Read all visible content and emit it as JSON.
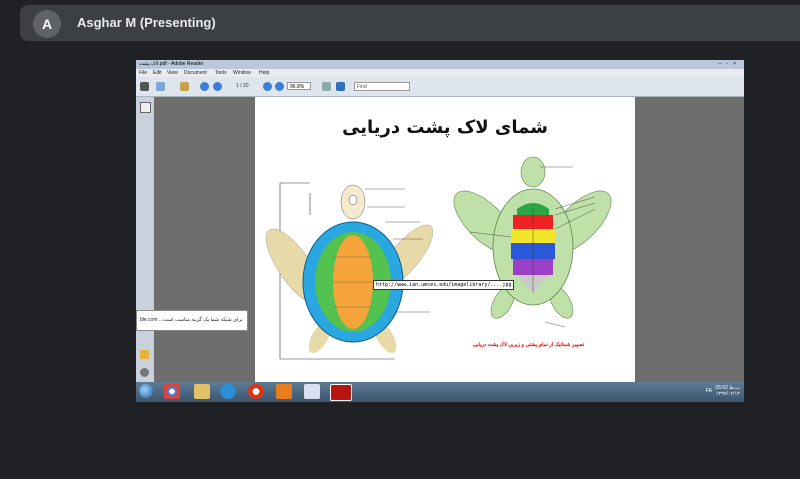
{
  "meet": {
    "avatar_letter": "A",
    "presenter_name": "Asghar M (Presenting)"
  },
  "reader": {
    "window_title": "لاک پشت.pdf - Adobe Reader",
    "menu": [
      "File",
      "Edit",
      "View",
      "Document",
      "Tools",
      "Window",
      "Help"
    ],
    "page_current": "1",
    "page_total": "/ 20",
    "zoom": "96.8%",
    "find_placeholder": "Find"
  },
  "document": {
    "title": "شمای لاک پشت دریایی",
    "url_label": "http://www.ian.umces.edu/imagelibrary/....jpg",
    "caption": "تصویر شماتیک از نمای پشتی و زیرین لاک پشت دریایی"
  },
  "tooltip_text": "ble.com  ...برای شبکه شما یک گزینه مناسب است",
  "taskbar": {
    "tray_text": "FA",
    "clock_time": "05:52 ب.ظ",
    "clock_date": "۱۳۹۹/۰۲/۱۴"
  },
  "colors": {
    "background": "#202124",
    "presenter_bar": "#3c4043",
    "title_red": "#d00000"
  }
}
